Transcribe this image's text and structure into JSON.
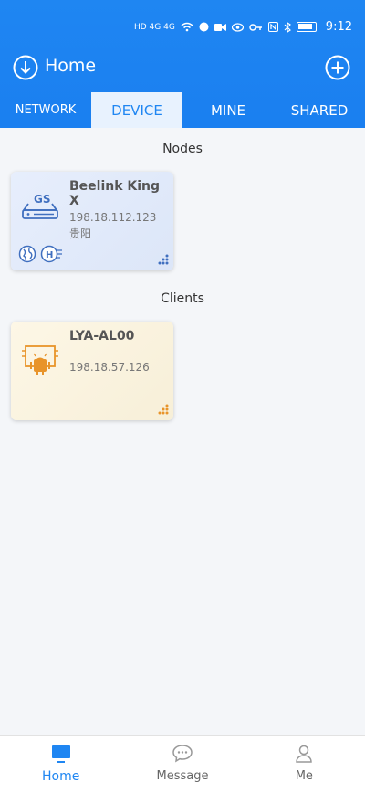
{
  "status": {
    "left_indicators": "HD 4G 4G",
    "time": "9:12"
  },
  "header": {
    "title": "Home"
  },
  "tabs": [
    {
      "label": "NETWORK",
      "active": false
    },
    {
      "label": "DEVICE",
      "active": true
    },
    {
      "label": "MINE",
      "active": false
    },
    {
      "label": "SHARED",
      "active": false
    }
  ],
  "nodes": {
    "heading": "Nodes",
    "items": [
      {
        "name": "Beelink King X",
        "ip": "198.18.112.123",
        "location": "贵阳",
        "icon": "router-gs-icon"
      }
    ]
  },
  "clients": {
    "heading": "Clients",
    "items": [
      {
        "name": "LYA-AL00",
        "ip": "198.18.57.126",
        "icon": "android-device-icon"
      }
    ]
  },
  "bottom_nav": [
    {
      "label": "Home",
      "active": true,
      "icon": "monitor-icon"
    },
    {
      "label": "Message",
      "active": false,
      "icon": "chat-bubble-icon"
    },
    {
      "label": "Me",
      "active": false,
      "icon": "person-icon"
    }
  ],
  "colors": {
    "primary": "#1f86f2",
    "node_card": "#dfe8f9",
    "client_card": "#fbf4df",
    "client_accent": "#e8942a"
  }
}
